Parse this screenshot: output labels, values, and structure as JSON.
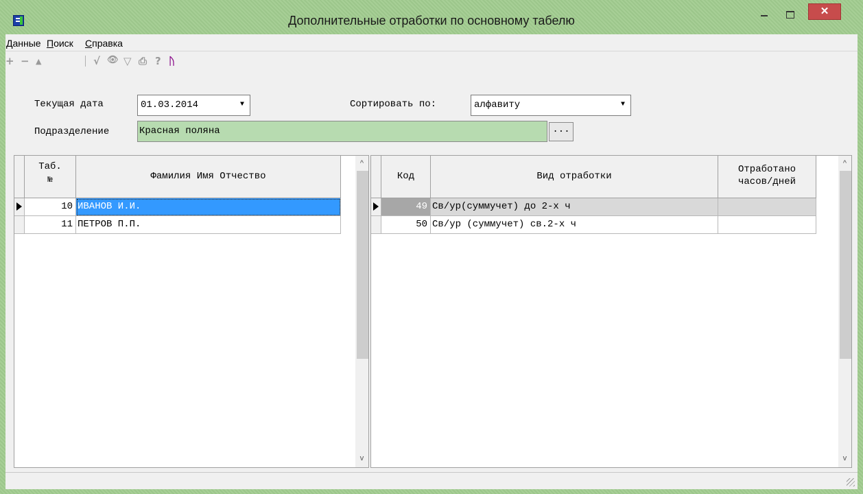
{
  "window": {
    "title": "Дополнительные отработки по основному табелю",
    "close_glyph": "✕"
  },
  "menu": [
    {
      "pre": "",
      "hotkey": "Д",
      "rest": "анные"
    },
    {
      "pre": "",
      "hotkey": "П",
      "rest": "оиск"
    },
    {
      "pre": "",
      "hotkey": "С",
      "rest": "правка"
    }
  ],
  "toolbar": {
    "icons": [
      "plus-icon",
      "minus-icon",
      "up-icon",
      "check-icon",
      "binoculars-icon",
      "filter-icon",
      "print-icon",
      "help-icon",
      "exit-icon"
    ],
    "glyphs": {
      "plus": "+",
      "minus": "−",
      "up": "▲",
      "check": "√",
      "find": "👁",
      "filter": "▽",
      "print": "⎙",
      "help": "?",
      "exit": "ᚢ"
    }
  },
  "filters": {
    "date_label": "Текущая дата",
    "date_value": "01.03.2014",
    "sort_label": "Сортировать по:",
    "sort_value": "алфавиту",
    "dept_label": "Подразделение",
    "dept_value": "Красная поляна",
    "dots_label": "...",
    "dropdown_glyph": "▼"
  },
  "employees": {
    "headers": {
      "tab_line1": "Таб.",
      "tab_line2": "№",
      "name": "Фамилия Имя Отчество"
    },
    "rows": [
      {
        "tab": "10",
        "name": "ИВАНОВ И.И."
      },
      {
        "tab": "11",
        "name": "ПЕТРОВ П.П."
      }
    ]
  },
  "work": {
    "headers": {
      "code": "Код",
      "type": "Вид отработки",
      "worked_line1": "Отработано",
      "worked_line2": "часов/дней"
    },
    "rows": [
      {
        "code": "49",
        "type": "Св/ур(суммучет) до 2-х ч",
        "worked": ""
      },
      {
        "code": "50",
        "type": "Св/ур (суммучет) св.2-х ч",
        "worked": ""
      }
    ]
  },
  "scroll": {
    "up": "^",
    "down": "v"
  }
}
